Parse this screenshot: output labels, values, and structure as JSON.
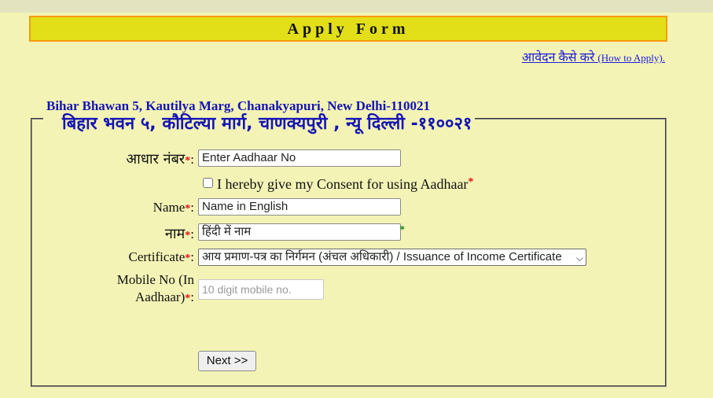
{
  "header": {
    "title": "Apply Form"
  },
  "help_link": {
    "hindi": "आवेदन कैसे करे ",
    "english": "(How to Apply)."
  },
  "fieldset": {
    "legend_en": "Bihar Bhawan 5, Kautilya Marg, Chanakyapuri, New Delhi-110021",
    "legend_hi": "बिहार भवन ५, कौटिल्या मार्ग, चाणक्यपुरी , न्यू दिल्ली -११००२१"
  },
  "form": {
    "aadhaar": {
      "label": "आधार नंबर",
      "placeholder": "Enter Aadhaar No"
    },
    "consent": {
      "label": "I hereby give my Consent for using Aadhaar",
      "checked": false
    },
    "name": {
      "label": "Name",
      "placeholder": "Name in English"
    },
    "name_hindi": {
      "label": "नाम",
      "placeholder": "हिंदी में नाम"
    },
    "certificate": {
      "label": "Certificate",
      "selected": "आय प्रमाण-पत्र का निर्गमन (अंचल अधिकारी) / Issuance of Income Certificate"
    },
    "mobile": {
      "label_line1": "Mobile No (In",
      "label_line2": "Aadhaar)",
      "placeholder": "10 digit mobile no."
    },
    "required_mark": "*",
    "colon": ":",
    "next_button": "Next >>"
  },
  "colors": {
    "header_bg": "#e2df18",
    "header_border": "#f59b0b",
    "page_bg": "#f3f3b6",
    "link": "#1c1ce0",
    "legend": "#1414b4",
    "required": "#e01010",
    "hindi_required": "#1a8a1a"
  }
}
